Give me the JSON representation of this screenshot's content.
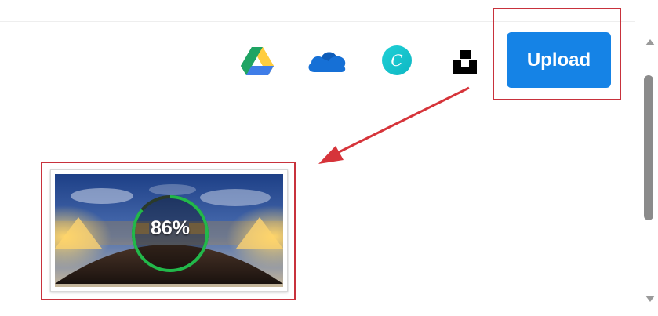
{
  "toolbar": {
    "sources": [
      {
        "name": "google-drive",
        "icon": "google-drive-icon"
      },
      {
        "name": "onedrive",
        "icon": "onedrive-icon",
        "color": "#1670d6"
      },
      {
        "name": "canva",
        "icon": "canva-icon",
        "letter": "C",
        "color": "#16c3c3"
      },
      {
        "name": "unsplash",
        "icon": "unsplash-icon",
        "color": "#000000"
      }
    ],
    "upload_label": "Upload",
    "upload_color": "#1583e6"
  },
  "thumbnail": {
    "progress_text": "86%",
    "progress": 0.86,
    "ring_color": "#22b84a"
  },
  "annotation": {
    "highlight_color": "#c8323c",
    "arrow_color": "#d6343a"
  }
}
